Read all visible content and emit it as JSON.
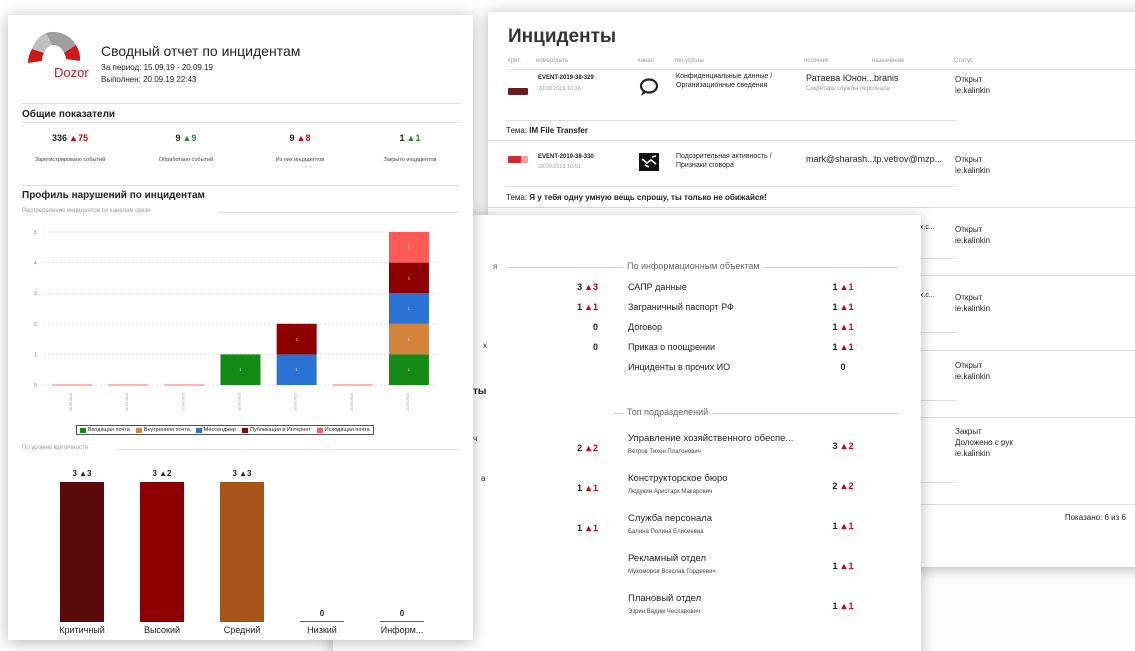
{
  "colors": {
    "critical": "#5a0a0a",
    "high": "#8e0000",
    "medium": "#a8531a",
    "up_red": "#d40000",
    "up_green": "#1e8a1e",
    "email_in": "#138a13",
    "email_int": "#d4843a",
    "messenger": "#2a73d4",
    "publication": "#8e0000",
    "email_out": "#ff5a5a"
  },
  "incidents": {
    "title": "Инциденты",
    "headers": [
      "крит.",
      "номер/дата",
      "канал",
      "тип угрозы",
      "источник",
      "назначение",
      "Статус"
    ],
    "rows": [
      {
        "event": "EVENT-2019-38-329",
        "date": "20.09.2019 10:36",
        "channel_icon": "chat-bubble-icon",
        "threat": "Конфиденциальные данные / Организационные сведения",
        "source": "Ратаева Юнон...",
        "source_sub": "Секретарь службы персонала",
        "dest": "branis",
        "status": "Открыт",
        "user": "ie.kalinkin",
        "topic_label": "Тема:",
        "topic": "IM File Transfer"
      },
      {
        "event": "EVENT-2019-38-330",
        "date": "20.09.2019 10:51",
        "channel_icon": "handshake-icon",
        "threat": "Подозрительная активность / Признаки сговора",
        "source": "mark@sharash...",
        "dest": "tp.vetrov@mzp...",
        "status": "Открыт",
        "user": "ie.kalinkin",
        "topic_label": "Тема:",
        "topic": "Я у тебя одну умную вещь спрошу, ты только не обижайся!"
      }
    ],
    "extra_rows": [
      {
        "dest": "ox.c...",
        "status": "Открыт",
        "user": "ie.kalinkin"
      },
      {
        "dest": "ox.c...",
        "status": "Открыт",
        "user": "ie.kalinkin"
      },
      {
        "status": "Открыт",
        "user": "ie.kalinkin"
      },
      {
        "status": "Закрыт",
        "status2": "Доложено с рук",
        "user": "ie.kalinkin"
      }
    ],
    "shown": "Показано: 6 из 6"
  },
  "middle": {
    "left_counts": [
      {
        "v": "3",
        "d": "▲3"
      },
      {
        "v": "1",
        "d": "▲1"
      },
      {
        "v": "0",
        "d": ""
      },
      {
        "v": "0",
        "d": ""
      }
    ],
    "left_frag": [
      "я",
      "х",
      "ты",
      "ч",
      "а"
    ],
    "info_objects_title": "По информационным объектам",
    "info_objects": [
      {
        "name": "САПР данные",
        "v": "1",
        "d": "▲1"
      },
      {
        "name": "Заграничный паспорт РФ",
        "v": "1",
        "d": "▲1"
      },
      {
        "name": "Договор",
        "v": "1",
        "d": "▲1"
      },
      {
        "name": "Приказ о поощрении",
        "v": "1",
        "d": "▲1"
      },
      {
        "name": "Инциденты в прочих ИО",
        "v": "0",
        "d": ""
      }
    ],
    "left_counts2": [
      {
        "v": "2",
        "d": "▲2"
      },
      {
        "v": "1",
        "d": "▲1"
      },
      {
        "v": "1",
        "d": "▲1"
      }
    ],
    "departments_title": "Топ подразделений",
    "departments": [
      {
        "name": "Управление хозяйственного обеспе...",
        "person": "Ветров Тихон Платонович",
        "v": "3",
        "d": "▲2"
      },
      {
        "name": "Конструкторское бюро",
        "person": "Людукин Аристарх Макарович",
        "v": "2",
        "d": "▲2"
      },
      {
        "name": "Служба персонала",
        "person": "Балина Полина Елисеевна",
        "v": "1",
        "d": "▲1"
      },
      {
        "name": "Рекламный отдел",
        "person": "Мухоморов Всеслав Гордеевич",
        "v": "1",
        "d": "▲1"
      },
      {
        "name": "Плановый отдел",
        "person": "Эзрин Вадим Чеславович",
        "v": "1",
        "d": "▲1"
      }
    ]
  },
  "report": {
    "logo_text": "Dozor",
    "title": "Сводный отчет по инцидентам",
    "period": "За период: 15.09.19 - 20.09.19",
    "done": "Выполнен: 20.09.19 22:43",
    "general_title": "Общие показатели",
    "kpis": [
      {
        "v": "336",
        "d": "▲75",
        "dcolor": "red",
        "label": "Зарегистрировано событий"
      },
      {
        "v": "9",
        "d": "▲9",
        "dcolor": "green",
        "label": "Обработано событий"
      },
      {
        "v": "9",
        "d": "▲8",
        "dcolor": "red",
        "label": "Из них инцидентов"
      },
      {
        "v": "1",
        "d": "▲1",
        "dcolor": "green",
        "label": "Закрыто инцидентов"
      }
    ],
    "profile_title": "Профиль нарушений по инцидентам",
    "channels_subtitle": "Распределение инцидентов по каналам связи",
    "criticality_subtitle": "По уровню критичности"
  },
  "chart_data": [
    {
      "type": "bar",
      "stacked": true,
      "title": "Распределение инцидентов по каналам связи",
      "categories": [
        "15.09.2019",
        "16.09.2019",
        "17.09.2019",
        "18.09.2019",
        "19.09.2019",
        "20.09.2019",
        "21.09.2019"
      ],
      "ylim": [
        0,
        5
      ],
      "yticks": [
        "0",
        "1",
        "2",
        "3",
        "4",
        "5"
      ],
      "series": [
        {
          "name": "Входящая почта",
          "color": "#138a13",
          "values": [
            0,
            0,
            0,
            1,
            0,
            0,
            1
          ]
        },
        {
          "name": "Внутренняя почта",
          "color": "#d4843a",
          "values": [
            0,
            0,
            0,
            0,
            0,
            0,
            1
          ]
        },
        {
          "name": "Мессенджер",
          "color": "#2a73d4",
          "values": [
            0,
            0,
            0,
            0,
            1,
            0,
            1
          ]
        },
        {
          "name": "Публикация в Интернет",
          "color": "#8e0000",
          "values": [
            0,
            0,
            0,
            0,
            1,
            0,
            1
          ]
        },
        {
          "name": "Исходящая почта",
          "color": "#ff5a5a",
          "values": [
            0,
            0,
            0,
            0,
            0,
            0,
            1
          ]
        }
      ],
      "legend": "bottom",
      "grid": true
    },
    {
      "type": "bar",
      "title": "По уровню критичности",
      "categories": [
        "Критичный",
        "Высокий",
        "Средний",
        "Низкий",
        "Информ..."
      ],
      "values": [
        3,
        3,
        3,
        0,
        0
      ],
      "deltas": [
        "▲3",
        "▲2",
        "▲3",
        "",
        ""
      ],
      "colors": [
        "#5a0a0a",
        "#8e0000",
        "#a8531a",
        "#138a13",
        "#138a13"
      ]
    }
  ]
}
